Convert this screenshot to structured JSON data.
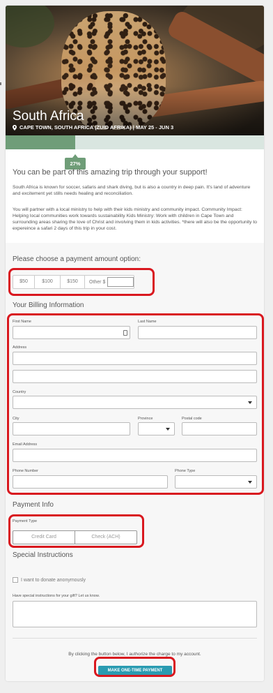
{
  "trip": {
    "title": "South Africa",
    "subtitle": "CAPE TOWN, SOUTH AFRICA (ZUID AFRIKA) | MAY 25 - JUN 3",
    "progress": 0.27,
    "progress_label": "27%"
  },
  "intro": {
    "heading": "You can be part of this amazing trip through your support!",
    "paragraph1": "South Africa is known for soccer, safaris and shark diving, but is also a country in deep pain. It's land of adventure and excitement yet stills needs healing and reconciliation.",
    "paragraph2": "You will partner with a local ministry to help with their kids ministry and community impact. Community Impact: Helping local communities work towards sustainability Kids Ministry: Work with children in Cape Town and surrounding areas sharing the love of Christ and involving them in kids activities. *there will also be the opportunity to expereince a safari 2 days of this trip in your cost."
  },
  "amount": {
    "heading": "Please choose a payment amount option:",
    "options": [
      "$50",
      "$100",
      "$150"
    ],
    "other_label": "Other $"
  },
  "billing": {
    "heading": "Your Billing Information",
    "first_name": "First Name",
    "last_name": "Last Name",
    "address": "Address",
    "country": "Country",
    "city": "City",
    "province": "Province",
    "postal": "Postal code",
    "email": "Email Address",
    "phone": "Phone Number",
    "phone_type": "Phone Type"
  },
  "payment": {
    "heading": "Payment Info",
    "type_label": "Payment Type",
    "options": [
      "Credit Card",
      "Check (ACH)"
    ]
  },
  "special": {
    "heading": "Special Instructions",
    "anonymous_label": "I want to donate anonymously",
    "instructions_label": "Have special instructions for your gift? Let us know."
  },
  "footer": {
    "consent": "By clicking the button below, I authorize the charge to my account.",
    "submit": "MAKE ONE-TIME PAYMENT"
  },
  "colors": {
    "accent": "#2a9bb1",
    "progress": "#6f9d78",
    "highlight": "#d9181f"
  }
}
